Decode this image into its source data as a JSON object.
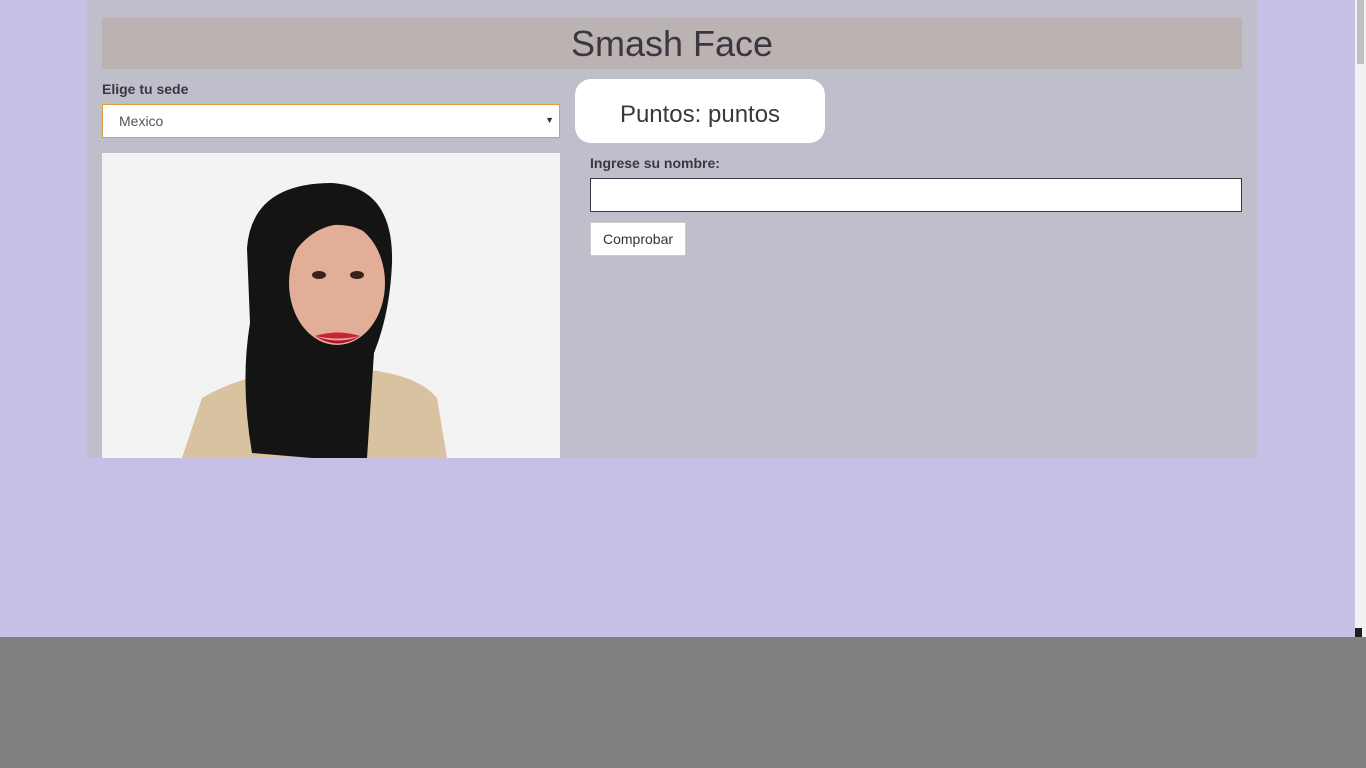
{
  "header": {
    "title": "Smash Face"
  },
  "sede": {
    "label": "Elige tu sede",
    "selected": "Mexico"
  },
  "score": {
    "text": "Puntos: puntos"
  },
  "name_form": {
    "label": "Ingrese su nombre:",
    "value": "",
    "placeholder": "",
    "button_label": "Comprobar"
  },
  "colors": {
    "page_background": "#c7bfe6",
    "panel_background": "#bfbfcb",
    "title_bar": "#bbb2b2",
    "text": "#3b3741",
    "select_border": "#e49b3c"
  },
  "photo": {
    "icon": "person-portrait"
  }
}
